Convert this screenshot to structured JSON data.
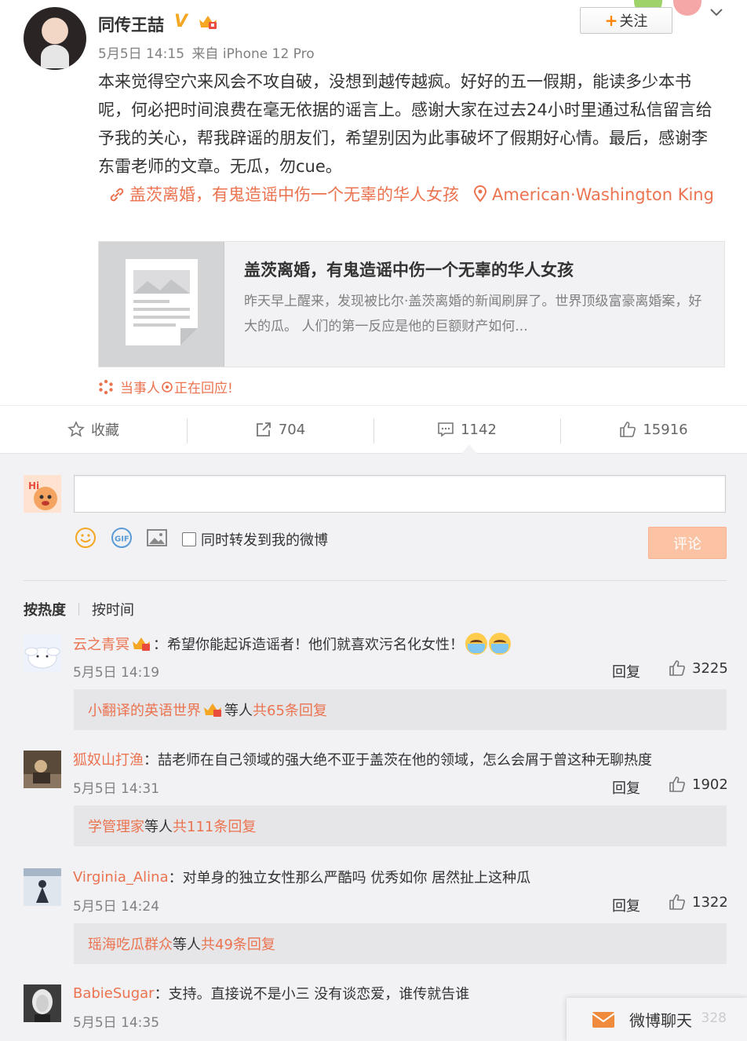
{
  "post": {
    "author": "同传王喆",
    "badge_v": "V",
    "date": "5月5日 14:15",
    "source": "来自 iPhone 12 Pro",
    "follow_label": "关注",
    "follow_plus": "+",
    "text": "本来觉得空穴来风会不攻自破，没想到越传越疯。好好的五一假期，能读多少本书呢，何必把时间浪费在毫无依据的谣言上。感谢大家在过去24小时里通过私信留言给予我的关心，帮我辟谣的朋友们，希望别因为此事破坏了假期好心情。最后，感谢李东雷老师的文章。无瓜，勿cue。",
    "link_text": "盖茨离婚，有鬼造谣中伤一个无辜的华人女孩",
    "location_text": "American·Washington King",
    "card": {
      "title": "盖茨离婚，有鬼造谣中伤一个无辜的华人女孩",
      "desc": "昨天早上醒来，发现被比尔·盖茨离婚的新闻刷屏了。世界顶级富豪离婚案，好大的瓜。 人们的第一反应是他的巨额财产如何..."
    },
    "respond_a": "当事人",
    "respond_b": "正在回应!"
  },
  "actions": {
    "favorite": "收藏",
    "reposts": "704",
    "comments": "1142",
    "likes": "15916"
  },
  "composer": {
    "repost_also": "同时转发到我的微博",
    "submit": "评论"
  },
  "sort": {
    "hot": "按热度",
    "time": "按时间"
  },
  "comments": [
    {
      "name": "云之青冥",
      "text": "希望你能起诉造谣者！他们就喜欢污名化女性！",
      "time": "5月5日 14:19",
      "reply": "回复",
      "likes": "3225",
      "sub_name": "小翻译的英语世界",
      "sub_mid": " 等人 ",
      "sub_count": "共65条回复"
    },
    {
      "name": "狐奴山打渔",
      "text": "喆老师在自己领域的强大绝不亚于盖茨在他的领域，怎么会屑于曾这种无聊热度",
      "time": "5月5日 14:31",
      "reply": "回复",
      "likes": "1902",
      "sub_name": "学管理家",
      "sub_mid": " 等人 ",
      "sub_count": "共111条回复"
    },
    {
      "name": "Virginia_Alina",
      "text": "对单身的独立女性那么严酷吗 优秀如你 居然扯上这种瓜",
      "time": "5月5日 14:24",
      "reply": "回复",
      "likes": "1322",
      "sub_name": "瑶海吃瓜群众",
      "sub_mid": " 等人 ",
      "sub_count": "共49条回复"
    },
    {
      "name": "BabieSugar",
      "text": "支持。直接说不是小三 没有谈恋爱，谁传就告谁",
      "time": "5月5日 14:35"
    }
  ],
  "chat": {
    "label": "微博聊天",
    "ghost": "328"
  },
  "colors": {
    "accent": "#eb7350",
    "follow_plus": "#ff8200",
    "verified": "#f5a623",
    "panel_bg": "#f2f2f5"
  },
  "icons": [
    "link-icon",
    "location-icon",
    "article-placeholder-icon",
    "asterisk-icon",
    "star-icon",
    "repost-icon",
    "comment-icon",
    "thumb-up-icon",
    "smiley-icon",
    "gif-icon",
    "image-icon",
    "mail-icon",
    "chevron-down-icon",
    "crown-badge-icon"
  ]
}
